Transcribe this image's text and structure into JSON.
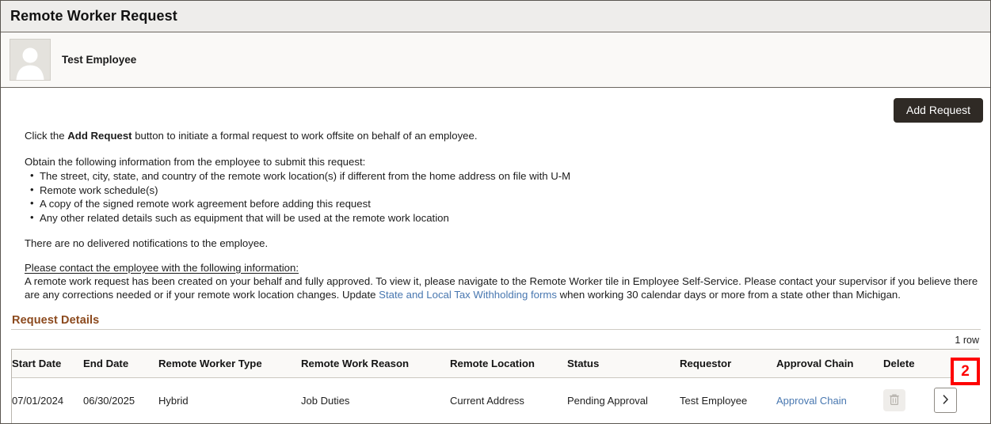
{
  "header": {
    "title": "Remote Worker Request"
  },
  "employee": {
    "name": "Test Employee",
    "avatar_icon": "person-placeholder-icon"
  },
  "toolbar": {
    "add_request_label": "Add Request"
  },
  "instructions": {
    "intro_before": "Click the ",
    "intro_strong": "Add Request",
    "intro_after": " button to initiate a formal request to work offsite on behalf of an employee.",
    "obtain_heading": "Obtain the following information from the employee to submit this request:",
    "bullets": [
      "The street, city, state, and country of the remote work location(s) if different from the home address on file with U-M",
      "Remote work schedule(s)",
      "A copy of the signed remote work agreement before adding this request",
      "Any other related details such as equipment that will be used at the remote work location"
    ],
    "no_notifications": "There are no delivered notifications to the employee.",
    "contact_heading": "Please contact the employee with the following information:",
    "contact_body_1": "A remote work request has been created on your behalf and fully approved. To view it, please navigate to the Remote Worker tile in Employee Self-Service. Please contact your supervisor if you believe there are any corrections needed or if your remote work location changes. Update ",
    "contact_link": "State and Local Tax Withholding forms",
    "contact_body_2": " when working 30 calendar days or more from a state other than Michigan."
  },
  "request_details": {
    "section_title": "Request Details",
    "row_count": "1 row",
    "columns": [
      "Start Date",
      "End Date",
      "Remote Worker Type",
      "Remote Work Reason",
      "Remote Location",
      "Status",
      "Requestor",
      "Approval Chain",
      "Delete",
      ""
    ],
    "rows": [
      {
        "start_date": "07/01/2024",
        "end_date": "06/30/2025",
        "remote_worker_type": "Hybrid",
        "remote_work_reason": "Job Duties",
        "remote_location": "Current Address",
        "status": "Pending Approval",
        "requestor": "Test Employee",
        "approval_chain": "Approval Chain",
        "delete_icon": "trash-icon",
        "detail_icon": "chevron-right-icon"
      }
    ]
  },
  "annotations": [
    {
      "id": "anno-2",
      "label": "2",
      "color": "#fe0000"
    }
  ]
}
